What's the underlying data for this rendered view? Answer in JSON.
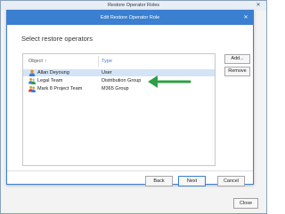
{
  "outer_window": {
    "title": "Restore Operator Roles",
    "close_label": "Close",
    "close_icon_glyph": "✕"
  },
  "dialog": {
    "title": "Edit Restore Operator Role",
    "close_icon_glyph": "✕",
    "heading": "Select restore operators",
    "table": {
      "columns": {
        "object": "Object",
        "sort_glyph": "↑",
        "type": "Type"
      },
      "rows": [
        {
          "name": "Allan Deyoung",
          "type": "User",
          "icon": "user-icon",
          "selected": true
        },
        {
          "name": "Legal Team",
          "type": "Distribution Group",
          "icon": "group-icon",
          "selected": false
        },
        {
          "name": "Mark 8 Project Team",
          "type": "M365 Group",
          "icon": "m365-group-icon",
          "selected": false
        }
      ]
    },
    "buttons": {
      "add": "Add...",
      "remove": "Remove",
      "back": "Back",
      "next": "Next",
      "cancel": "Cancel"
    }
  },
  "annotation": {
    "color": "#2ea043",
    "points_to": "Legal Team row"
  },
  "colors": {
    "accent": "#3b7fd0",
    "selection": "#d3e4f7"
  }
}
